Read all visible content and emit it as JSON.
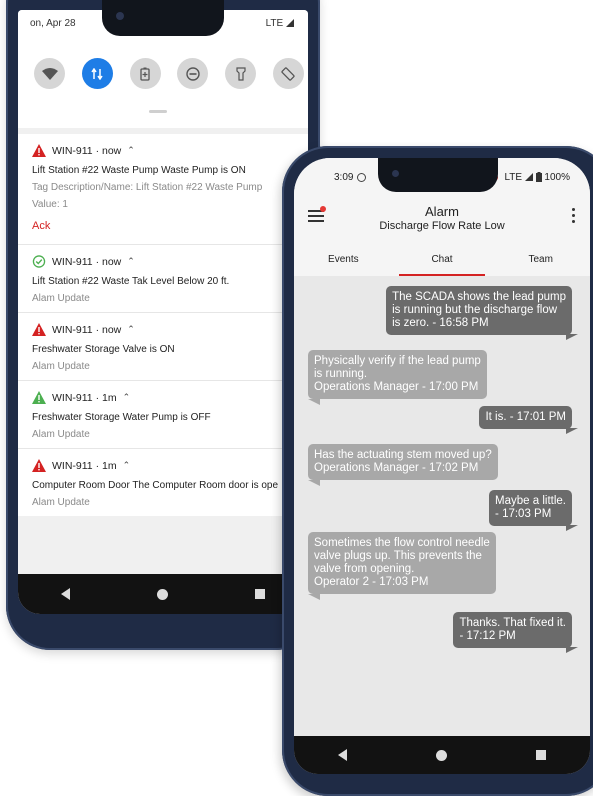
{
  "phone1": {
    "status_bar": {
      "date": "on, Apr 28",
      "network": "LTE"
    },
    "quick_settings": [
      {
        "icon": "wifi-icon",
        "active": false
      },
      {
        "icon": "data-transfer-icon",
        "active": true
      },
      {
        "icon": "battery-saver-icon",
        "active": false
      },
      {
        "icon": "do-not-disturb-icon",
        "active": false
      },
      {
        "icon": "flashlight-icon",
        "active": false
      },
      {
        "icon": "auto-rotate-icon",
        "active": false
      }
    ],
    "notifications": [
      {
        "icon": "warning-triangle-red",
        "app": "WIN-911 · now",
        "title": "Lift Station #22 Waste Pump Waste Pump is ON",
        "subtitle": "Tag Description/Name: Lift Station #22 Waste Pump",
        "value": "Value: 1",
        "action": "Ack"
      },
      {
        "icon": "check-circle-green",
        "app": "WIN-911 · now",
        "title": "Lift Station #22 Waste Tak Level Below 20 ft.",
        "subtitle": "Alam Update"
      },
      {
        "icon": "warning-triangle-red",
        "app": "WIN-911 · now",
        "title": "Freshwater Storage Valve is ON",
        "subtitle": "Alam Update"
      },
      {
        "icon": "warning-triangle-green",
        "app": "WIN-911 · 1m",
        "title": "Freshwater Storage Water Pump is OFF",
        "subtitle": "Alam Update"
      },
      {
        "icon": "warning-triangle-red",
        "app": "WIN-911 · 1m",
        "title": "Computer Room Door The Computer Room door is ope",
        "subtitle": "Alam Update"
      }
    ]
  },
  "phone2": {
    "status_bar": {
      "time": "3:09",
      "network": "LTE",
      "battery": "100%"
    },
    "appbar": {
      "title": "Alarm",
      "subtitle": "Discharge Flow Rate Low"
    },
    "tabs": [
      {
        "label": "Events",
        "active": false
      },
      {
        "label": "Chat",
        "active": true
      },
      {
        "label": "Team",
        "active": false
      }
    ],
    "messages": [
      {
        "dir": "out",
        "lines": [
          "The SCADA shows the lead pump",
          "is running but the discharge flow",
          "is zero. - 16:58 PM"
        ]
      },
      {
        "dir": "in",
        "lines": [
          "Physically verify if the lead pump",
          "is running.",
          "Operations Manager - 17:00 PM"
        ]
      },
      {
        "dir": "out",
        "lines": [
          "It is. - 17:01 PM"
        ]
      },
      {
        "dir": "in",
        "lines": [
          "Has the actuating stem moved up?",
          "Operations Manager - 17:02 PM"
        ]
      },
      {
        "dir": "out",
        "lines": [
          "Maybe a little.",
          "- 17:03 PM"
        ]
      },
      {
        "dir": "in",
        "lines": [
          "Sometimes the flow control needle",
          "valve plugs up. This prevents the",
          "valve from opening.",
          "Operator 2 - 17:03 PM"
        ]
      },
      {
        "dir": "out",
        "lines": [
          "Thanks. That fixed it.",
          "- 17:12 PM"
        ]
      }
    ]
  },
  "colors": {
    "accent_blue": "#1e7de6",
    "alert_red": "#d42222",
    "ok_green": "#4caf50",
    "bubble_out": "#6b6b6b",
    "bubble_in": "#a8a8a8"
  }
}
